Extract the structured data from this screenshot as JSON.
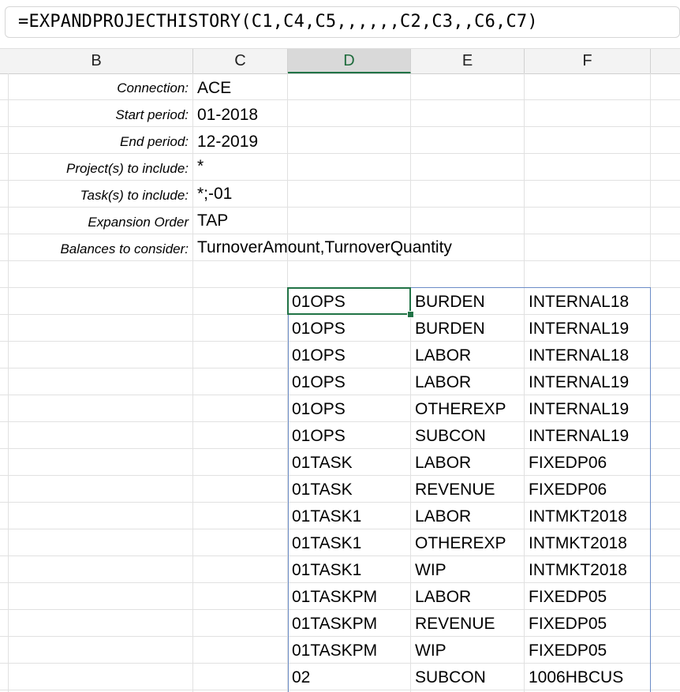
{
  "formula_bar": {
    "text": "=EXPANDPROJECTHISTORY(C1,C4,C5,,,,,,C2,C3,,C6,C7)"
  },
  "columns": [
    "B",
    "C",
    "D",
    "E",
    "F"
  ],
  "selected_column": "D",
  "parameters": [
    {
      "label": "Connection:",
      "value": "ACE"
    },
    {
      "label": "Start period:",
      "value": "01-2018"
    },
    {
      "label": "End period:",
      "value": "12-2019"
    },
    {
      "label": "Project(s) to include:",
      "value": "*"
    },
    {
      "label": "Task(s) to include:",
      "value": "*;-01"
    },
    {
      "label": "Expansion Order",
      "value": "TAP"
    },
    {
      "label": "Balances to consider:",
      "value": "TurnoverAmount,TurnoverQuantity"
    }
  ],
  "results": [
    {
      "project": "01OPS",
      "category": "BURDEN",
      "code": "INTERNAL18"
    },
    {
      "project": "01OPS",
      "category": "BURDEN",
      "code": "INTERNAL19"
    },
    {
      "project": "01OPS",
      "category": "LABOR",
      "code": "INTERNAL18"
    },
    {
      "project": "01OPS",
      "category": "LABOR",
      "code": "INTERNAL19"
    },
    {
      "project": "01OPS",
      "category": "OTHEREXP",
      "code": "INTERNAL19"
    },
    {
      "project": "01OPS",
      "category": "SUBCON",
      "code": "INTERNAL19"
    },
    {
      "project": "01TASK",
      "category": "LABOR",
      "code": "FIXEDP06"
    },
    {
      "project": "01TASK",
      "category": "REVENUE",
      "code": "FIXEDP06"
    },
    {
      "project": "01TASK1",
      "category": "LABOR",
      "code": "INTMKT2018"
    },
    {
      "project": "01TASK1",
      "category": "OTHEREXP",
      "code": "INTMKT2018"
    },
    {
      "project": "01TASK1",
      "category": "WIP",
      "code": "INTMKT2018"
    },
    {
      "project": "01TASKPM",
      "category": "LABOR",
      "code": "FIXEDP05"
    },
    {
      "project": "01TASKPM",
      "category": "REVENUE",
      "code": "FIXEDP05"
    },
    {
      "project": "01TASKPM",
      "category": "WIP",
      "code": "FIXEDP05"
    },
    {
      "project": "02",
      "category": "SUBCON",
      "code": "1006HBCUS"
    }
  ]
}
